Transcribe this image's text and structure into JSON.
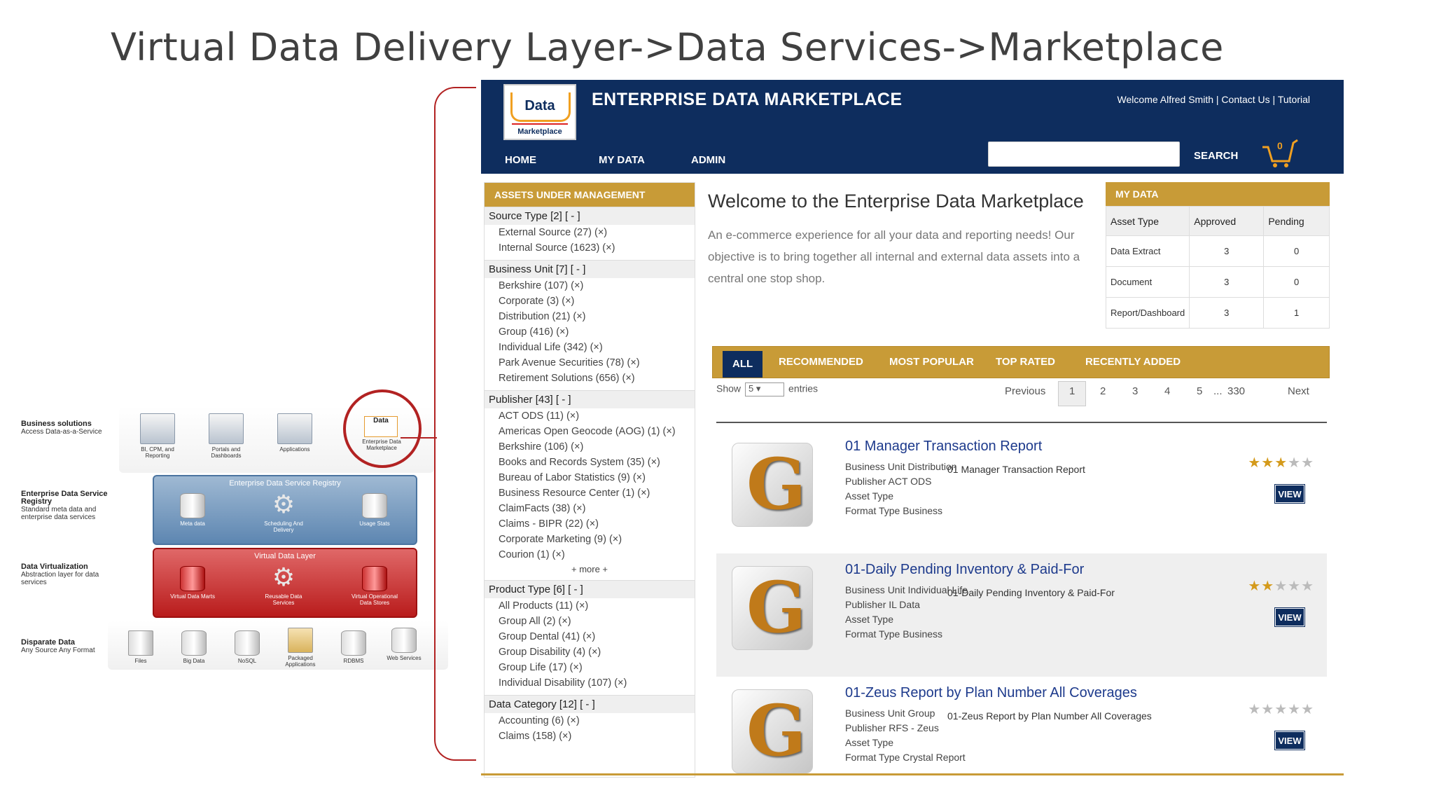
{
  "slide_title": "Virtual Data Delivery Layer->Data Services->Marketplace",
  "diagram": {
    "layers": [
      {
        "title": "Business solutions",
        "desc": "Access Data-as-a-Service"
      },
      {
        "title": "Enterprise Data Service Registry",
        "desc": "Standard meta data and enterprise data services"
      },
      {
        "title": "Data Virtualization",
        "desc": "Abstraction layer for data services"
      },
      {
        "title": "Disparate Data",
        "desc": "Any Source Any Format"
      }
    ],
    "top_icons": [
      "BI, CPM, and Reporting",
      "Portals and Dashboards",
      "Applications",
      "Enterprise Data Marketplace"
    ],
    "registry_title": "Enterprise Data Service Registry",
    "registry_icons": [
      "Meta data",
      "Scheduling And Delivery",
      "Usage Stats"
    ],
    "vdl_title": "Virtual Data Layer",
    "vdl_icons": [
      "Virtual Data Marts",
      "Reusable Data Services",
      "Virtual Operational Data Stores"
    ],
    "source_icons": [
      "Files",
      "Big Data",
      "NoSQL",
      "Packaged Applications",
      "RDBMS",
      "Web Services"
    ],
    "mini_logo": "Data"
  },
  "app": {
    "logo_text": "Data",
    "logo_sub": "Marketplace",
    "title": "ENTERPRISE DATA MARKETPLACE",
    "top_links": "Welcome  Alfred Smith | Contact Us | Tutorial",
    "nav": [
      "HOME",
      "MY DATA",
      "ADMIN"
    ],
    "search_placeholder": "",
    "search_label": "SEARCH",
    "cart_count": "0"
  },
  "facets": {
    "header": "ASSETS UNDER MANAGEMENT",
    "groups": [
      {
        "title": "Source Type [2] [ - ]",
        "items": [
          "External Source (27) (×)",
          "Internal Source (1623) (×)"
        ]
      },
      {
        "title": "Business Unit [7] [ - ]",
        "items": [
          "Berkshire (107) (×)",
          "Corporate (3) (×)",
          "Distribution (21) (×)",
          "Group (416) (×)",
          "Individual Life (342) (×)",
          "Park Avenue Securities (78) (×)",
          "Retirement Solutions (656) (×)"
        ]
      },
      {
        "title": "Publisher [43] [ - ]",
        "items": [
          "ACT ODS (11) (×)",
          "Americas Open Geocode (AOG) (1) (×)",
          "Berkshire (106) (×)",
          "Books and Records System (35) (×)",
          "Bureau of Labor Statistics (9) (×)",
          "Business Resource Center (1) (×)",
          "ClaimFacts (38) (×)",
          "Claims - BIPR (22) (×)",
          "Corporate Marketing (9) (×)",
          "Courion (1) (×)"
        ],
        "more": "+ more +"
      },
      {
        "title": "Product Type [6] [ - ]",
        "items": [
          "All Products (11) (×)",
          "Group All (2) (×)",
          "Group Dental (41) (×)",
          "Group Disability (4) (×)",
          "Group Life (17) (×)",
          "Individual Disability (107) (×)"
        ]
      },
      {
        "title": "Data Category [12] [ - ]",
        "items": [
          "Accounting (6) (×)",
          "Claims (158) (×)"
        ]
      }
    ]
  },
  "welcome": {
    "title": "Welcome to the Enterprise Data Marketplace",
    "text": "An e-commerce experience for all your data and reporting needs! Our objective is to bring together all internal and external data assets into a central one stop shop."
  },
  "mydata": {
    "header": "MY DATA",
    "columns": [
      "Asset Type",
      "Approved",
      "Pending"
    ],
    "rows": [
      [
        "Data Extract",
        "3",
        "0"
      ],
      [
        "Document",
        "3",
        "0"
      ],
      [
        "Report/Dashboard",
        "3",
        "1"
      ]
    ]
  },
  "tabs": [
    "ALL",
    "RECOMMENDED",
    "MOST POPULAR",
    "TOP RATED",
    "RECENTLY ADDED"
  ],
  "listing": {
    "show_label": "Show",
    "show_value": "5",
    "entries_label": "entries",
    "pager": [
      "Previous",
      "1",
      "2",
      "3",
      "4",
      "5",
      "...",
      "330",
      "Next"
    ]
  },
  "results": [
    {
      "title": "01 Manager Transaction Report",
      "bu_label": "Business Unit",
      "bu": "Distribution",
      "pub_label": "Publisher",
      "pub": "ACT ODS",
      "asset_label": "Asset Type",
      "asset": "",
      "format_label": "Format Type",
      "format": "Business",
      "desc": "01 Manager Transaction Report",
      "rating": 3,
      "view": "VIEW"
    },
    {
      "title": "01-Daily Pending Inventory & Paid-For",
      "bu_label": "Business Unit",
      "bu": "Individual Life",
      "pub_label": "Publisher",
      "pub": "IL Data",
      "asset_label": "Asset Type",
      "asset": "",
      "format_label": "Format Type",
      "format": "Business",
      "desc": "01-Daily Pending Inventory & Paid-For",
      "rating": 2,
      "view": "VIEW"
    },
    {
      "title": "01-Zeus Report by Plan Number All Coverages",
      "bu_label": "Business Unit",
      "bu": "Group",
      "pub_label": "Publisher",
      "pub": "RFS - Zeus",
      "asset_label": "Asset Type",
      "asset": "",
      "format_label": "Format Type",
      "format": "Crystal Report",
      "desc": "01-Zeus Report by Plan Number All Coverages",
      "rating": 0,
      "view": "VIEW"
    }
  ]
}
